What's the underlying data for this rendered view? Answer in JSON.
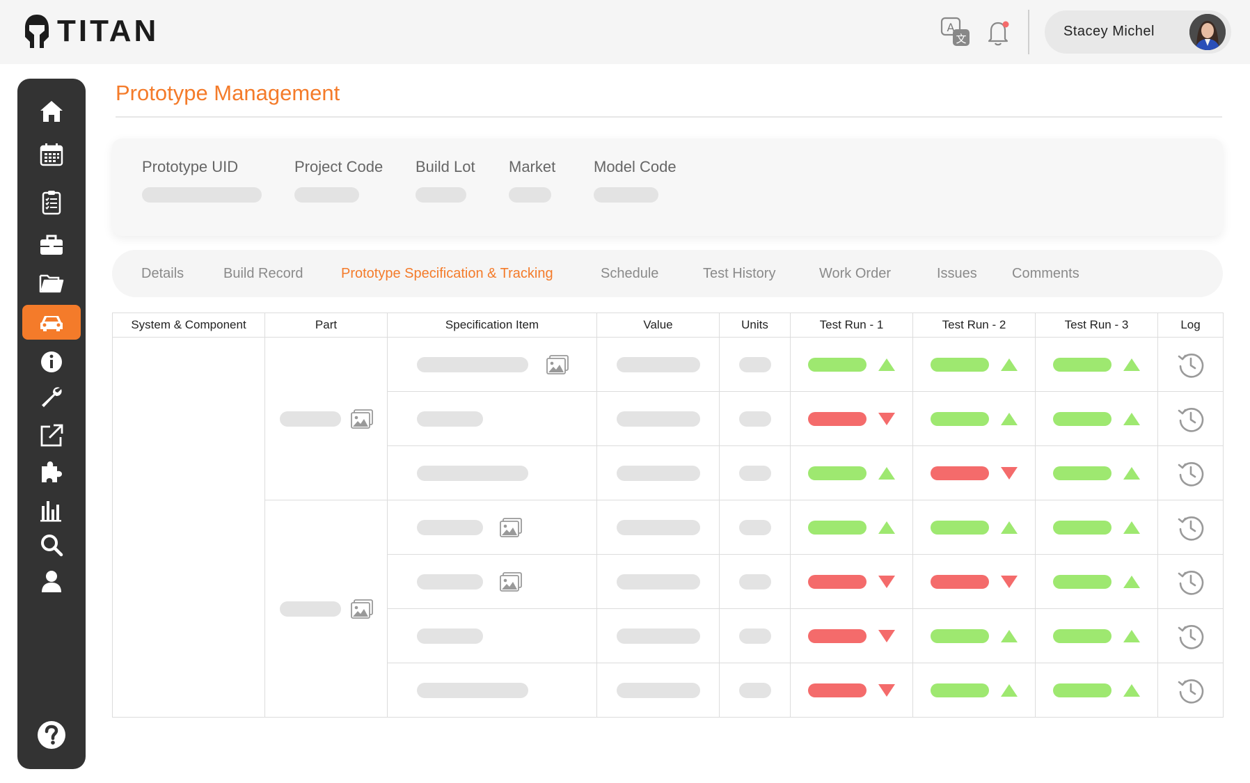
{
  "app": {
    "name": "TITAN"
  },
  "user": {
    "name": "Stacey Michel"
  },
  "page": {
    "title": "Prototype Management"
  },
  "info_fields": [
    {
      "label": "Prototype UID"
    },
    {
      "label": "Project Code"
    },
    {
      "label": "Build Lot"
    },
    {
      "label": "Market"
    },
    {
      "label": "Model Code"
    }
  ],
  "tabs": [
    {
      "label": "Details"
    },
    {
      "label": "Build Record"
    },
    {
      "label": "Prototype Specification & Tracking",
      "active": true
    },
    {
      "label": "Schedule"
    },
    {
      "label": "Test History"
    },
    {
      "label": "Work Order"
    },
    {
      "label": "Issues"
    },
    {
      "label": "Comments"
    }
  ],
  "sidebar_icons": [
    "home-icon",
    "calendar-icon",
    "checklist-icon",
    "briefcase-icon",
    "folder-icon",
    "car-icon",
    "info-icon",
    "wrench-icon",
    "external-link-icon",
    "puzzle-icon",
    "bar-chart-icon",
    "search-icon",
    "user-icon",
    "help-icon"
  ],
  "colors": {
    "accent": "#f47b2a",
    "pass": "#9ee870",
    "fail": "#f46b6b",
    "sidebar": "#333333"
  },
  "table": {
    "headers": [
      "System & Component",
      "Part",
      "Specification Item",
      "Value",
      "Units",
      "Test Run - 1",
      "Test Run - 2",
      "Test Run - 3",
      "Log"
    ],
    "rows": [
      {
        "runs": [
          "pass",
          "pass",
          "pass"
        ]
      },
      {
        "runs": [
          "fail",
          "pass",
          "pass"
        ]
      },
      {
        "runs": [
          "pass",
          "fail",
          "pass"
        ]
      },
      {
        "runs": [
          "pass",
          "pass",
          "pass"
        ]
      },
      {
        "runs": [
          "fail",
          "fail",
          "pass"
        ]
      },
      {
        "runs": [
          "fail",
          "pass",
          "pass"
        ]
      },
      {
        "runs": [
          "fail",
          "pass",
          "pass"
        ]
      }
    ]
  }
}
